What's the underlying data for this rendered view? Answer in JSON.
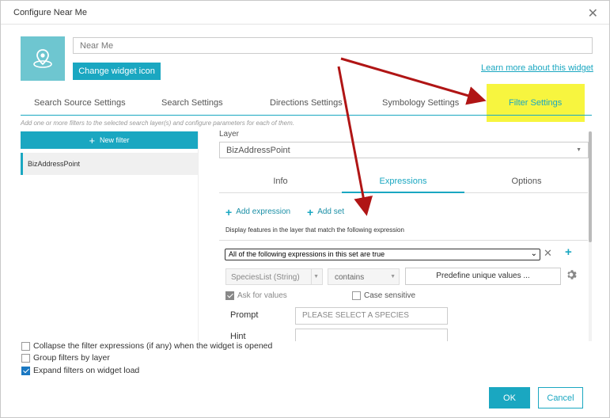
{
  "window": {
    "title": "Configure Near Me",
    "close_glyph": "✕"
  },
  "widget": {
    "icon": "location-pin-icon",
    "name_value": "Near Me",
    "change_icon_label": "Change widget icon",
    "learn_more_label": "Learn more about this widget"
  },
  "tabs": [
    {
      "label": "Search Source Settings"
    },
    {
      "label": "Search Settings"
    },
    {
      "label": "Directions Settings"
    },
    {
      "label": "Symbology Settings"
    },
    {
      "label": "Filter Settings",
      "active": true
    }
  ],
  "hint_text": "Add one or more filters to the selected search layer(s) and configure parameters for each of them.",
  "filters": {
    "new_filter_label": "New filter",
    "items": [
      {
        "label": "BizAddressPoint"
      }
    ]
  },
  "layer": {
    "label": "Layer",
    "value": "BizAddressPoint"
  },
  "subtabs": [
    {
      "label": "Info"
    },
    {
      "label": "Expressions",
      "active": true
    },
    {
      "label": "Options"
    }
  ],
  "expressions": {
    "add_expression_label": "Add expression",
    "add_set_label": "Add set",
    "display_text": "Display features in the layer that match the following expression",
    "set_condition": "All of the following expressions in this set are true",
    "field": "SpeciesList (String)",
    "operator": "contains",
    "predefine_label": "Predefine unique values ...",
    "ask_for_values_label": "Ask for values",
    "ask_for_values_checked": true,
    "case_sensitive_label": "Case sensitive",
    "case_sensitive_checked": false,
    "prompt_label": "Prompt",
    "prompt_value": "PLEASE SELECT A SPECIES",
    "hint_label": "Hint",
    "hint_value": ""
  },
  "options": {
    "collapse_label": "Collapse the filter expressions (if any) when the widget is opened",
    "collapse_checked": false,
    "group_label": "Group filters by layer",
    "group_checked": false,
    "expand_label": "Expand filters on widget load",
    "expand_checked": true
  },
  "buttons": {
    "ok_label": "OK",
    "cancel_label": "Cancel"
  },
  "colors": {
    "accent": "#1aa7c1",
    "highlight": "#f7f53f",
    "arrow": "#b01515"
  }
}
